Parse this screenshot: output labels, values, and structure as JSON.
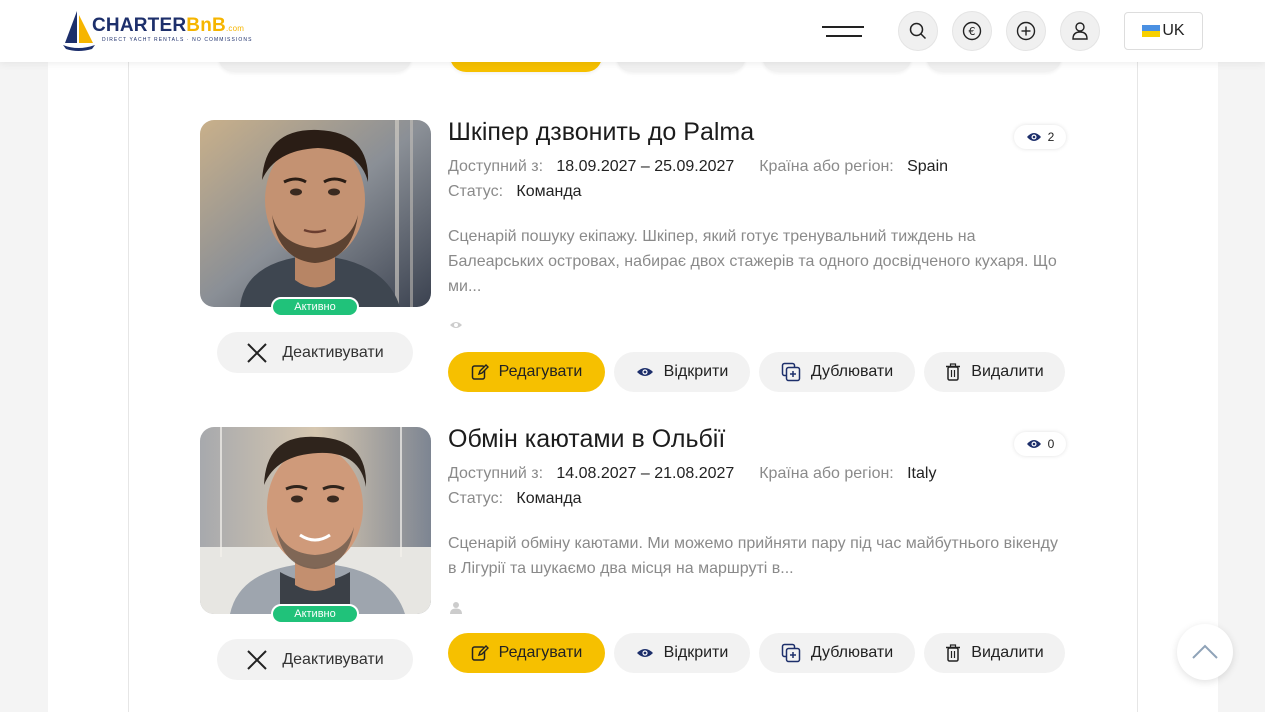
{
  "header": {
    "logo": {
      "name": "CHARTER",
      "accent": "BnB",
      "suffix": ".com",
      "tagline": "DIRECT YACHT RENTALS · NO COMMISSIONS"
    },
    "icons": [
      "menu-icon",
      "search-icon",
      "euro-icon",
      "add-icon",
      "user-icon"
    ],
    "language_label": "UK"
  },
  "colors": {
    "accent": "#f6c000",
    "active": "#20c27a",
    "navy": "#1d2f6b"
  },
  "listings": [
    {
      "title": "Шкіпер дзвонить до Palma",
      "views": "2",
      "available_label": "Доступний з:",
      "available_value": "18.09.2027 – 25.09.2027",
      "region_label": "Країна або регіон:",
      "region_value": "Spain",
      "status_label": "Статус:",
      "status_value": "Команда",
      "description": "Сценарій пошуку екіпажу. Шкіпер, який готує тренувальний тиждень на Балеарських островах, набирає двох стажерів та одного досвідченого кухаря. Що ми...",
      "badge": "Активно",
      "deactivate_label": "Деактивувати",
      "actions": {
        "edit": "Редагувати",
        "open": "Відкрити",
        "duplicate": "Дублювати",
        "delete": "Видалити"
      }
    },
    {
      "title": "Обмін каютами в Ольбії",
      "views": "0",
      "available_label": "Доступний з:",
      "available_value": "14.08.2027 – 21.08.2027",
      "region_label": "Країна або регіон:",
      "region_value": "Italy",
      "status_label": "Статус:",
      "status_value": "Команда",
      "description": "Сценарій обміну каютами. Ми можемо прийняти пару під час майбутнього вікенду в Лігурії та шукаємо два місця на маршруті в...",
      "badge": "Активно",
      "deactivate_label": "Деактивувати",
      "actions": {
        "edit": "Редагувати",
        "open": "Відкрити",
        "duplicate": "Дублювати",
        "delete": "Видалити"
      }
    }
  ]
}
